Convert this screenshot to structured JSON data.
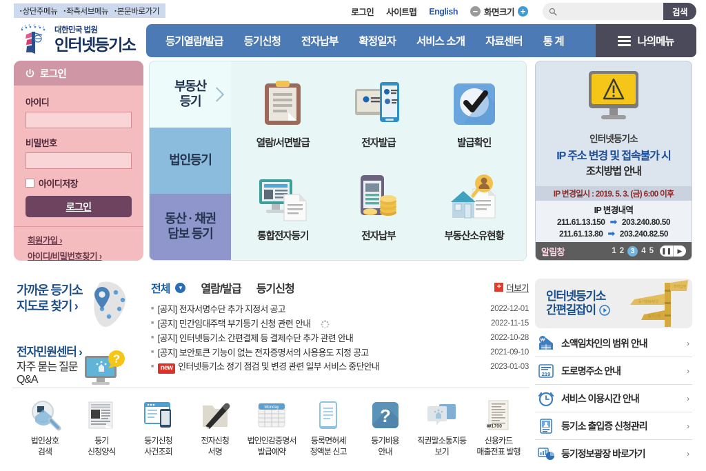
{
  "skip_links": [
    "상단주메뉴",
    "좌측서브메뉴",
    "본문바로가기"
  ],
  "utility": {
    "login": "로그인",
    "sitemap": "사이트맵",
    "english": "English",
    "zoom_label": "화면크기",
    "zoom_out": "−",
    "zoom_in": "+",
    "search_placeholder": "",
    "search_value": "",
    "search_button": "검색"
  },
  "logo": {
    "sub": "대한민국 법원",
    "main": "인터넷등기소"
  },
  "nav": {
    "items": [
      "등기열람/발급",
      "등기신청",
      "전자납부",
      "확정일자",
      "서비스 소개",
      "자료센터",
      "통 계"
    ],
    "mymenu": "나의메뉴"
  },
  "login_panel": {
    "header": "로그인",
    "id_label": "아이디",
    "id_value": "",
    "pw_label": "비밀번호",
    "pw_value": "",
    "remember_label": "아이디저장",
    "remember_checked": false,
    "login_button": "로그인",
    "signup": "회원가입",
    "find_account": "아이디/비밀번호찾기"
  },
  "banner": {
    "side_tabs": [
      {
        "label": "부동산\n등기",
        "line1": "부동산",
        "line2": "등기",
        "active": true
      },
      {
        "label": "법인등기",
        "line1": "법인등기",
        "line2": "",
        "active": false
      },
      {
        "label": "동산 · 채권 담보 등기",
        "line1": "동산 · 채권",
        "line2": "담보 등기",
        "active": false
      }
    ],
    "services": [
      {
        "label": "열람/서면발급",
        "icon": "clipboard-icon"
      },
      {
        "label": "전자발급",
        "icon": "tablet-phone-icon"
      },
      {
        "label": "발급확인",
        "icon": "check-circle-icon"
      },
      {
        "label": "통합전자등기",
        "icon": "monitor-document-icon"
      },
      {
        "label": "전자납부",
        "icon": "phone-coins-icon"
      },
      {
        "label": "부동산소유현황",
        "icon": "house-person-icon"
      }
    ]
  },
  "alert_panel": {
    "line1": "인터넷등기소",
    "line2": "IP 주소 변경 및 접속불가 시",
    "line3": "조치방법 안내",
    "ip_date": "IP 변경일시 : 2019. 5. 3. (금) 6:00 이후",
    "ip_title": "IP 변경내역",
    "ip_rows": [
      {
        "from": "211.61.13.150",
        "to": "203.240.80.50"
      },
      {
        "from": "211.61.13.80",
        "to": "203.240.82.50"
      }
    ],
    "footer_title": "알림창",
    "pages": [
      "1",
      "2",
      "3",
      "4",
      "5"
    ],
    "active_page": "3",
    "pause_label": "❚❚",
    "next_label": "▶"
  },
  "quick": {
    "map_title_line1": "가까운 등기소",
    "map_title_line2": "지도로 찾기",
    "faq_title": "전자민원센터",
    "faq_line1": "자주 묻는 질문",
    "faq_line2": "Q&A"
  },
  "notices": {
    "tabs": [
      {
        "label": "전체",
        "active": true
      },
      {
        "label": "열람/발급",
        "active": false
      },
      {
        "label": "등기신청",
        "active": false
      }
    ],
    "more": "더보기",
    "items": [
      {
        "title": "[공지] 전자서명수단 추가 지정서 공고",
        "date": "2022-12-01",
        "new": false,
        "loading": false
      },
      {
        "title": "[공지] 민간임대주택 부기등기 신청 관련 안내",
        "date": "2022-11-15",
        "new": false,
        "loading": true
      },
      {
        "title": "[공지] 인터넷등기소 간편결제 등 결제수단 추가 관련 안내",
        "date": "2022-10-28",
        "new": false,
        "loading": false
      },
      {
        "title": "[공지] 보안토큰 기능이 없는 전자증명서의 사용용도 지정 공고",
        "date": "2021-09-10",
        "new": false,
        "loading": false
      },
      {
        "title": "인터넷등기소 정기 점검 및 변경 관련 일부 서비스 중단안내",
        "date": "2023-01-03",
        "new": true,
        "new_badge": "new",
        "loading": false
      }
    ]
  },
  "guide": {
    "banner_line1": "인터넷등기소",
    "banner_line2": "간편길잡이",
    "links": [
      {
        "label": "소액임차인의 범위 안내",
        "icon": "house-won-icon"
      },
      {
        "label": "도로명주소 안내",
        "icon": "road-sign-219-icon"
      },
      {
        "label": "서비스 이용시간 안내",
        "icon": "alarm-clock-icon"
      },
      {
        "label": "등기소 출입증 신청관리",
        "icon": "id-card-icon"
      },
      {
        "label": "등기정보광장 바로가기",
        "icon": "chart-icon"
      }
    ]
  },
  "bottom_icons": [
    {
      "line1": "법인상호",
      "line2": "검색",
      "icon": "magnifier-icon"
    },
    {
      "line1": "등기",
      "line2": "신청양식",
      "icon": "form-document-icon"
    },
    {
      "line1": "등기신청",
      "line2": "사건조회",
      "icon": "browser-phone-icon"
    },
    {
      "line1": "전자신청",
      "line2": "서명",
      "icon": "pen-icon"
    },
    {
      "line1": "법인인감증명서",
      "line2": "발급예약",
      "icon": "calendar-icon"
    },
    {
      "line1": "등록면허세",
      "line2": "정액분 신고",
      "icon": "document-lines-icon"
    },
    {
      "line1": "등기비용",
      "line2": "안내",
      "icon": "question-mark-icon"
    },
    {
      "line1": "직권말소통지등",
      "line2": "보기",
      "icon": "speech-bubble-icon"
    },
    {
      "line1": "신용카드",
      "line2": "매출전표 발행",
      "icon": "receipt-icon"
    }
  ],
  "colors": {
    "nav_blue": "#4b7ab5",
    "mymenu_dark": "#4a4a5a",
    "login_pink": "#f5bcc0",
    "login_btn": "#6e4360",
    "banner_mint": "#e8f7f6",
    "tab_blue": "#8cbcdd",
    "tab_purple": "#8e96cc",
    "alert_bg": "#dce4ee",
    "accent_blue": "#1b4e8c",
    "new_red": "#d9332a",
    "warn_yellow": "#f5c518"
  }
}
